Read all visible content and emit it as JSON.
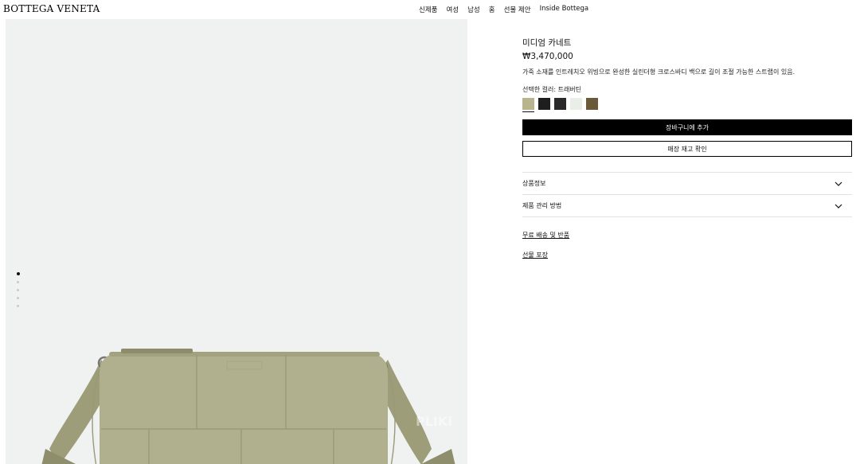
{
  "header": {
    "logo": "BOTTEGA VENETA",
    "nav": [
      "신제품",
      "여성",
      "남성",
      "홈",
      "선물 제안",
      "Inside Bottega"
    ]
  },
  "gallery": {
    "watermark": "PLIKI",
    "slides_total": 5,
    "active_slide": 1,
    "bag_color": "#a9a986"
  },
  "product": {
    "name": "미디엄 카네트",
    "price": "₩3,470,000",
    "description": "가죽 소재를 인트레치오 위빙으로 완성한 실린더형 크로스바디 백으로 길이 조절 가능한 스트랩이 있음.",
    "selected_color_label": "선택한 컬러: 트래버틴",
    "swatches": [
      {
        "color": "#b8b48e",
        "selected": true
      },
      {
        "color": "#1e1e1e",
        "selected": false
      },
      {
        "color": "#2a2a2a",
        "selected": false
      },
      {
        "color": "#e9efe7",
        "selected": false
      },
      {
        "color": "#6b5a3a",
        "selected": false
      }
    ]
  },
  "actions": {
    "add_to_bag": "장바구니에 추가",
    "check_store": "매장 재고 확인"
  },
  "accordion": {
    "product_info": "상품정보",
    "care": "제품 관리 방법"
  },
  "links": {
    "shipping": "무료 배송 및 반품",
    "gift": "선물 포장"
  }
}
